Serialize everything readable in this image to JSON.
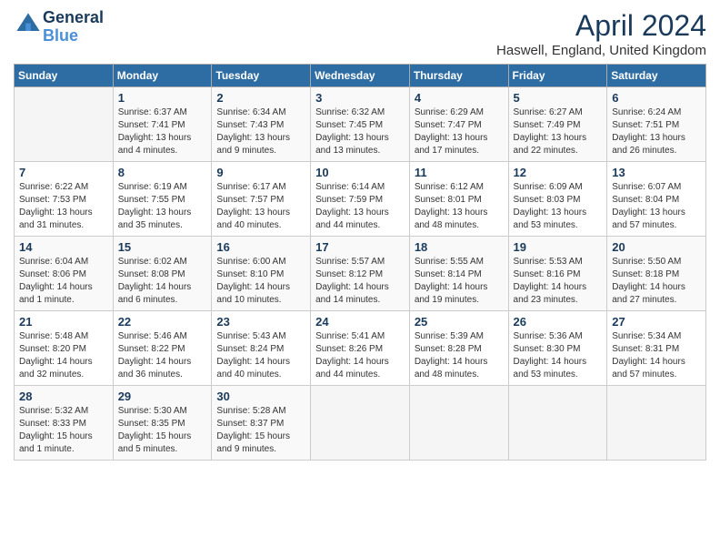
{
  "header": {
    "logo_line1": "General",
    "logo_line2": "Blue",
    "title": "April 2024",
    "location": "Haswell, England, United Kingdom"
  },
  "weekdays": [
    "Sunday",
    "Monday",
    "Tuesday",
    "Wednesday",
    "Thursday",
    "Friday",
    "Saturday"
  ],
  "weeks": [
    [
      {
        "day": "",
        "info": ""
      },
      {
        "day": "1",
        "info": "Sunrise: 6:37 AM\nSunset: 7:41 PM\nDaylight: 13 hours\nand 4 minutes."
      },
      {
        "day": "2",
        "info": "Sunrise: 6:34 AM\nSunset: 7:43 PM\nDaylight: 13 hours\nand 9 minutes."
      },
      {
        "day": "3",
        "info": "Sunrise: 6:32 AM\nSunset: 7:45 PM\nDaylight: 13 hours\nand 13 minutes."
      },
      {
        "day": "4",
        "info": "Sunrise: 6:29 AM\nSunset: 7:47 PM\nDaylight: 13 hours\nand 17 minutes."
      },
      {
        "day": "5",
        "info": "Sunrise: 6:27 AM\nSunset: 7:49 PM\nDaylight: 13 hours\nand 22 minutes."
      },
      {
        "day": "6",
        "info": "Sunrise: 6:24 AM\nSunset: 7:51 PM\nDaylight: 13 hours\nand 26 minutes."
      }
    ],
    [
      {
        "day": "7",
        "info": "Sunrise: 6:22 AM\nSunset: 7:53 PM\nDaylight: 13 hours\nand 31 minutes."
      },
      {
        "day": "8",
        "info": "Sunrise: 6:19 AM\nSunset: 7:55 PM\nDaylight: 13 hours\nand 35 minutes."
      },
      {
        "day": "9",
        "info": "Sunrise: 6:17 AM\nSunset: 7:57 PM\nDaylight: 13 hours\nand 40 minutes."
      },
      {
        "day": "10",
        "info": "Sunrise: 6:14 AM\nSunset: 7:59 PM\nDaylight: 13 hours\nand 44 minutes."
      },
      {
        "day": "11",
        "info": "Sunrise: 6:12 AM\nSunset: 8:01 PM\nDaylight: 13 hours\nand 48 minutes."
      },
      {
        "day": "12",
        "info": "Sunrise: 6:09 AM\nSunset: 8:03 PM\nDaylight: 13 hours\nand 53 minutes."
      },
      {
        "day": "13",
        "info": "Sunrise: 6:07 AM\nSunset: 8:04 PM\nDaylight: 13 hours\nand 57 minutes."
      }
    ],
    [
      {
        "day": "14",
        "info": "Sunrise: 6:04 AM\nSunset: 8:06 PM\nDaylight: 14 hours\nand 1 minute."
      },
      {
        "day": "15",
        "info": "Sunrise: 6:02 AM\nSunset: 8:08 PM\nDaylight: 14 hours\nand 6 minutes."
      },
      {
        "day": "16",
        "info": "Sunrise: 6:00 AM\nSunset: 8:10 PM\nDaylight: 14 hours\nand 10 minutes."
      },
      {
        "day": "17",
        "info": "Sunrise: 5:57 AM\nSunset: 8:12 PM\nDaylight: 14 hours\nand 14 minutes."
      },
      {
        "day": "18",
        "info": "Sunrise: 5:55 AM\nSunset: 8:14 PM\nDaylight: 14 hours\nand 19 minutes."
      },
      {
        "day": "19",
        "info": "Sunrise: 5:53 AM\nSunset: 8:16 PM\nDaylight: 14 hours\nand 23 minutes."
      },
      {
        "day": "20",
        "info": "Sunrise: 5:50 AM\nSunset: 8:18 PM\nDaylight: 14 hours\nand 27 minutes."
      }
    ],
    [
      {
        "day": "21",
        "info": "Sunrise: 5:48 AM\nSunset: 8:20 PM\nDaylight: 14 hours\nand 32 minutes."
      },
      {
        "day": "22",
        "info": "Sunrise: 5:46 AM\nSunset: 8:22 PM\nDaylight: 14 hours\nand 36 minutes."
      },
      {
        "day": "23",
        "info": "Sunrise: 5:43 AM\nSunset: 8:24 PM\nDaylight: 14 hours\nand 40 minutes."
      },
      {
        "day": "24",
        "info": "Sunrise: 5:41 AM\nSunset: 8:26 PM\nDaylight: 14 hours\nand 44 minutes."
      },
      {
        "day": "25",
        "info": "Sunrise: 5:39 AM\nSunset: 8:28 PM\nDaylight: 14 hours\nand 48 minutes."
      },
      {
        "day": "26",
        "info": "Sunrise: 5:36 AM\nSunset: 8:30 PM\nDaylight: 14 hours\nand 53 minutes."
      },
      {
        "day": "27",
        "info": "Sunrise: 5:34 AM\nSunset: 8:31 PM\nDaylight: 14 hours\nand 57 minutes."
      }
    ],
    [
      {
        "day": "28",
        "info": "Sunrise: 5:32 AM\nSunset: 8:33 PM\nDaylight: 15 hours\nand 1 minute."
      },
      {
        "day": "29",
        "info": "Sunrise: 5:30 AM\nSunset: 8:35 PM\nDaylight: 15 hours\nand 5 minutes."
      },
      {
        "day": "30",
        "info": "Sunrise: 5:28 AM\nSunset: 8:37 PM\nDaylight: 15 hours\nand 9 minutes."
      },
      {
        "day": "",
        "info": ""
      },
      {
        "day": "",
        "info": ""
      },
      {
        "day": "",
        "info": ""
      },
      {
        "day": "",
        "info": ""
      }
    ]
  ]
}
